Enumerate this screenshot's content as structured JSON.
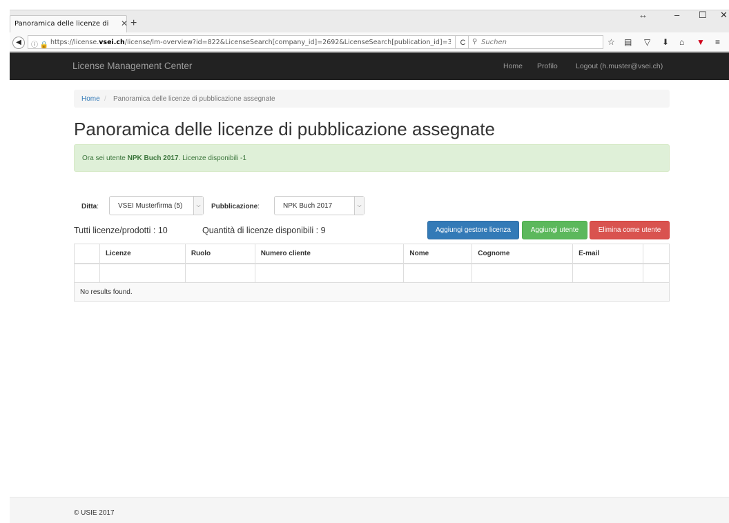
{
  "browser": {
    "tab_title": "Panoramica delle licenze di pu...",
    "tab_close": "✕",
    "new_tab": "+",
    "window_resize": "↔",
    "window_minimize": "–",
    "window_maximize": "☐",
    "window_close": "✕",
    "back": "◀",
    "url_prefix": "https://license.",
    "url_domain": "vsei.ch",
    "url_rest": "/license/lm-overview?id=822&LicenseSearch[company_id]=2692&LicenseSearch[publication_id]=3",
    "reload": "C",
    "search_placeholder": "Suchen"
  },
  "appnav": {
    "brand": "License Management Center",
    "links": [
      "Home",
      "Profilo",
      "Logout (h.muster@vsei.ch)"
    ]
  },
  "breadcrumb": {
    "home": "Home",
    "separator": "/",
    "current": "Panoramica delle licenze di pubblicazione assegnate"
  },
  "page": {
    "title": "Panoramica delle licenze di pubblicazione assegnate"
  },
  "alert": {
    "prefix": "Ora sei utente ",
    "highlight": "NPK Buch 2017",
    "suffix": ". Licenze disponibili -1"
  },
  "filters": {
    "company_label": "Ditta",
    "company_value": "VSEI Musterfirma (5)",
    "publication_label": "Pubblicazione",
    "publication_value": "NPK Buch 2017"
  },
  "summary": {
    "total": "Tutti licenze/prodotti : 10",
    "available": "Quantità di licenze disponibili : 9"
  },
  "actions": {
    "add_manager": "Aggiungi gestore licenza",
    "add_user": "Aggiungi utente",
    "remove_user": "Elimina come utente"
  },
  "table": {
    "columns": [
      "",
      "Licenze",
      "Ruolo",
      "Numero cliente",
      "Nome",
      "Cognome",
      "E-mail",
      ""
    ],
    "empty_message": "No results found."
  },
  "footer": {
    "copyright": "© USIE 2017"
  }
}
